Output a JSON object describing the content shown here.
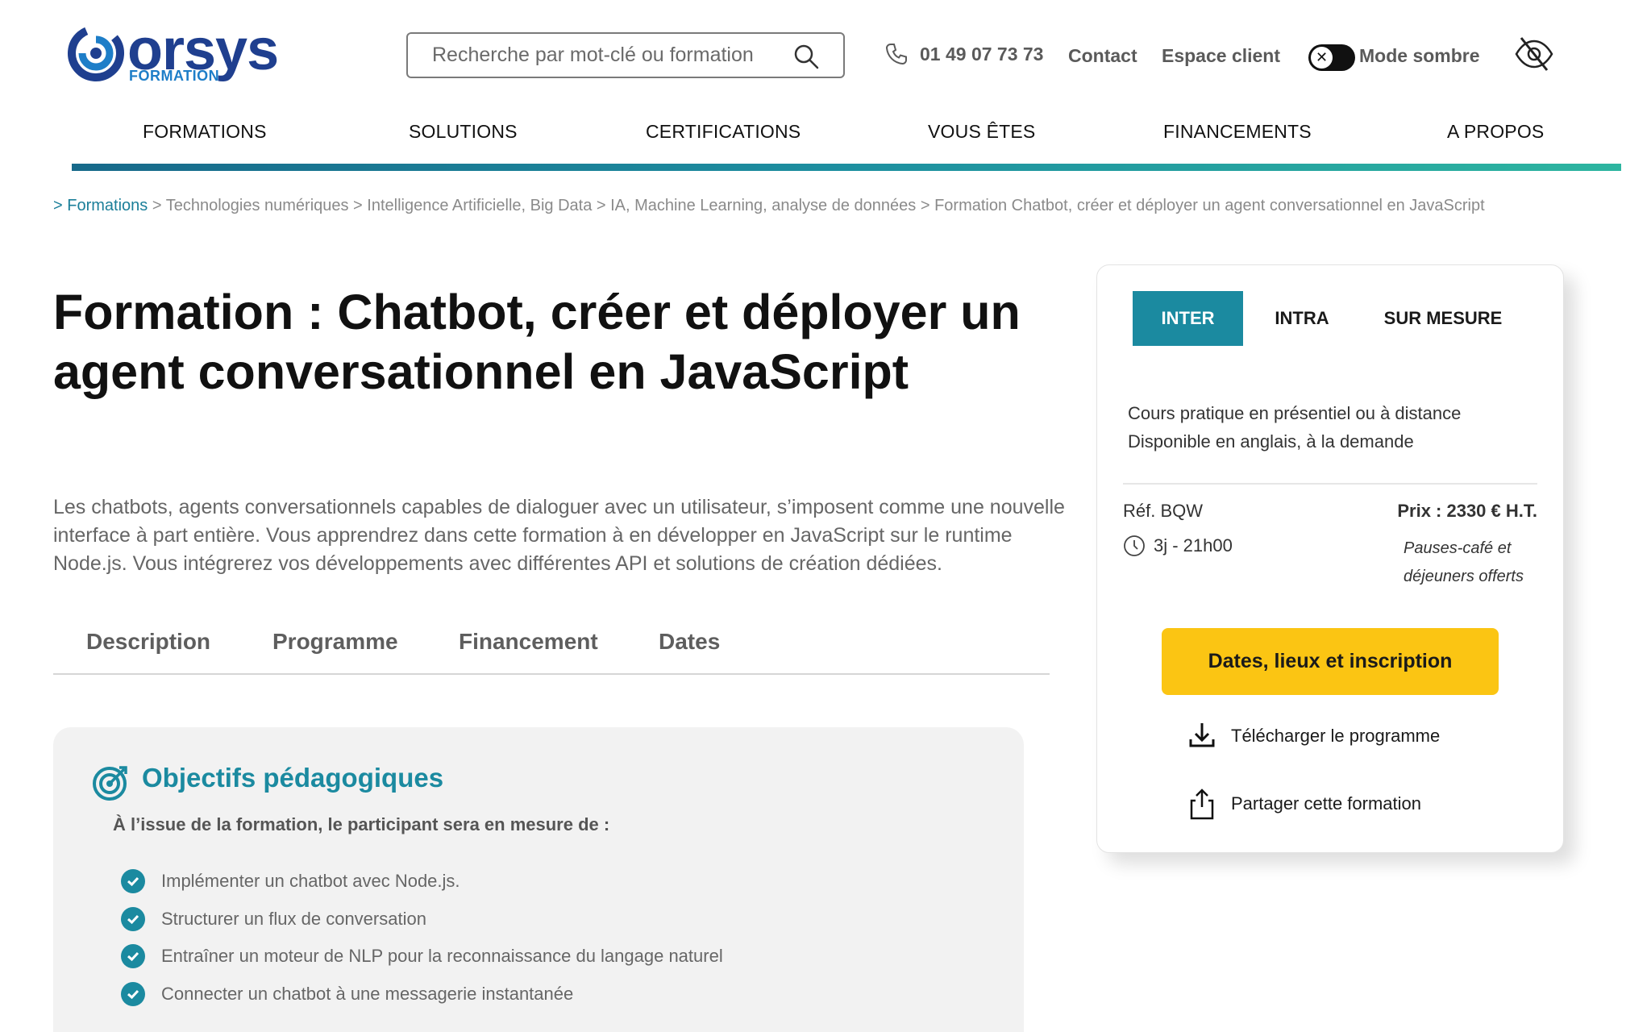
{
  "header": {
    "logo": {
      "brand": "orsys",
      "sub": "FORMATION"
    },
    "search_placeholder": "Recherche par mot-clé ou formation",
    "phone": "01 49 07 73 73",
    "contact_label": "Contact",
    "client_label": "Espace client",
    "dark_mode_label": "Mode sombre",
    "dark_mode_knob": "✕"
  },
  "nav": {
    "items": [
      "FORMATIONS",
      "SOLUTIONS",
      "CERTIFICATIONS",
      "VOUS ÊTES",
      "FINANCEMENTS",
      "A PROPOS"
    ]
  },
  "breadcrumb": {
    "first": "> Formations",
    "rest": " > Technologies numériques > Intelligence Artificielle, Big Data > IA, Machine Learning, analyse de données > Formation Chatbot, créer et déployer un agent conversationnel en JavaScript"
  },
  "main": {
    "title": "Formation : Chatbot, créer et déployer un agent conversationnel en JavaScript",
    "intro": "Les chatbots, agents conversationnels capables de dialoguer avec un utilisateur, s’imposent comme une nouvelle interface à part entière. Vous apprendrez dans cette formation à en développer en JavaScript sur le runtime Node.js. Vous intégrerez vos développements avec différentes API et solutions de création dédiées.",
    "tabs": [
      "Description",
      "Programme",
      "Financement",
      "Dates"
    ]
  },
  "objectives": {
    "title": "Objectifs pédagogiques",
    "subtitle": "À l’issue de la formation, le participant sera en mesure de :",
    "items": [
      "Implémenter un chatbot avec Node.js.",
      "Structurer un flux de conversation",
      "Entraîner un moteur de NLP pour la reconnaissance du langage naturel",
      "Connecter un chatbot à une messagerie instantanée"
    ]
  },
  "card": {
    "tabs": [
      "INTER",
      "INTRA",
      "SUR MESURE"
    ],
    "active_tab": "INTER",
    "desc_line1": "Cours pratique en présentiel ou à distance",
    "desc_line2": "Disponible en anglais, à la demande",
    "ref": "Réf. BQW",
    "duration": "3j - 21h00",
    "price": "Prix : 2330 € H.T.",
    "price_note": "Pauses-café et déjeuners offerts",
    "cta": "Dates, lieux et inscription",
    "download": "Télécharger le programme",
    "share": "Partager cette formation"
  },
  "colors": {
    "accent": "#1b8aa0",
    "brand_blue": "#1f3f8f",
    "cta_yellow": "#fbc513",
    "objectives_bg": "#f2f2f2"
  },
  "icons": [
    "search-icon",
    "phone-icon",
    "eye-off-icon",
    "target-icon",
    "check-icon",
    "clock-icon",
    "download-icon",
    "share-icon"
  ]
}
